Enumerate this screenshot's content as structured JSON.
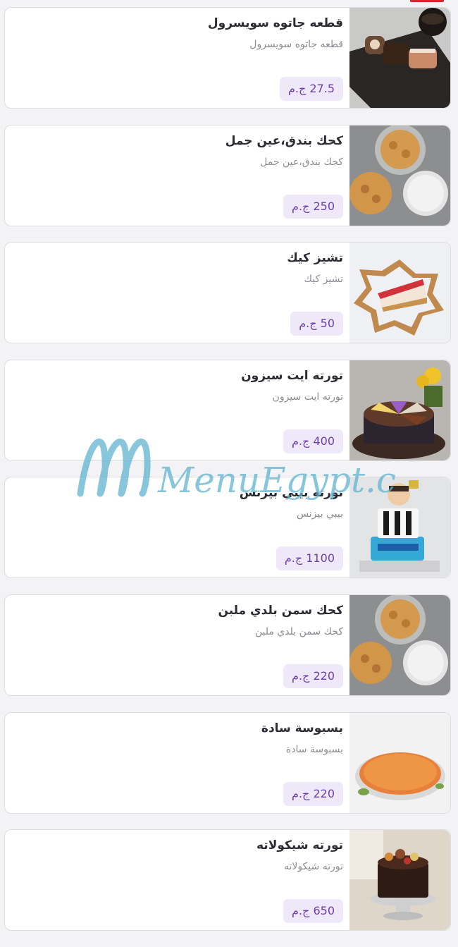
{
  "currency": "ج.م",
  "items": [
    {
      "title": "قطعه جاتوه سويسرول",
      "description": "قطعه جاتوه سويسرول",
      "price": "27.5 ج.م",
      "image": "swiss-roll-photo"
    },
    {
      "title": "كحك بندق،عين جمل",
      "description": "كحك بندق،عين جمل",
      "price": "250 ج.م",
      "image": "kahk-photo"
    },
    {
      "title": "تشيز كيك",
      "description": "تشيز كيك",
      "price": "50 ج.م",
      "image": "cheesecake-photo"
    },
    {
      "title": "تورته ايت سيزون",
      "description": "تورته ايت سيزون",
      "price": "400 ج.م",
      "image": "eight-season-cake-photo"
    },
    {
      "title": "تورته بيبي بيزنس",
      "description": "بيبي بيزنس",
      "price": "1100 ج.م",
      "image": "baby-business-cake-photo"
    },
    {
      "title": "كحك سمن بلدي ملبن",
      "description": "كحك سمن بلدي ملبن",
      "price": "220 ج.م",
      "image": "kahk-photo"
    },
    {
      "title": "بسبوسة سادة",
      "description": "بسبوسة سادة",
      "price": "220 ج.م",
      "image": "basbousa-photo"
    },
    {
      "title": "تورته شيكولاته",
      "description": "تورته شيكولاته",
      "price": "650 ج.م",
      "image": "chocolate-cake-photo"
    }
  ],
  "watermark": {
    "text": "MenuEgypt.com"
  },
  "colors": {
    "badge_bg": "#efe8f9",
    "badge_text": "#6b3fa8",
    "title": "#2b2b33",
    "description": "#8b8b93",
    "accent": "#d9262f",
    "watermark": "#5fb4cf"
  }
}
